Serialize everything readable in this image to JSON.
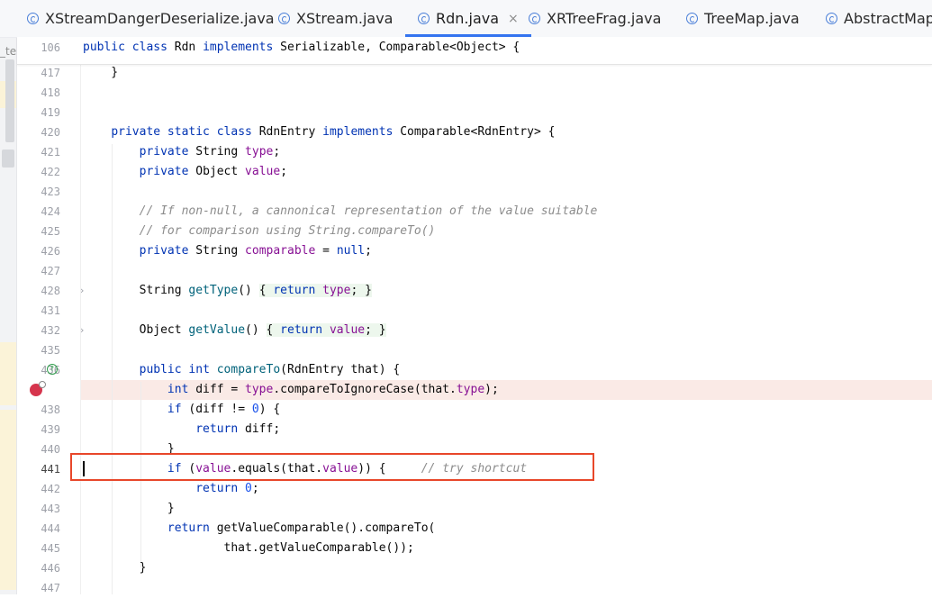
{
  "tabs": [
    {
      "label": "XStreamDangerDeserialize.java",
      "active": false
    },
    {
      "label": "XStream.java",
      "active": false
    },
    {
      "label": "Rdn.java",
      "active": true,
      "close": "×"
    },
    {
      "label": "XRTreeFrag.java",
      "active": false
    },
    {
      "label": "TreeMap.java",
      "active": false
    },
    {
      "label": "AbstractMap.ja",
      "active": false
    }
  ],
  "left_strip_fragment": "_te",
  "sticky_header": {
    "line_number": "106",
    "parts": [
      {
        "t": "public class ",
        "c": "kw"
      },
      {
        "t": "Rdn ",
        "c": ""
      },
      {
        "t": "implements ",
        "c": "kw"
      },
      {
        "t": "Serializable, Comparable<Object> {",
        "c": ""
      }
    ]
  },
  "code_lines": [
    {
      "n": "417",
      "parts": [
        {
          "t": "    }",
          "c": ""
        }
      ]
    },
    {
      "n": "418",
      "parts": []
    },
    {
      "n": "419",
      "parts": []
    },
    {
      "n": "420",
      "parts": [
        {
          "t": "    ",
          "c": ""
        },
        {
          "t": "private static class ",
          "c": "kw"
        },
        {
          "t": "RdnEntry ",
          "c": ""
        },
        {
          "t": "implements ",
          "c": "kw"
        },
        {
          "t": "Comparable<RdnEntry> {",
          "c": ""
        }
      ]
    },
    {
      "n": "421",
      "parts": [
        {
          "t": "        ",
          "c": ""
        },
        {
          "t": "private ",
          "c": "kw"
        },
        {
          "t": "String ",
          "c": ""
        },
        {
          "t": "type",
          "c": "fld"
        },
        {
          "t": ";",
          "c": ""
        }
      ]
    },
    {
      "n": "422",
      "parts": [
        {
          "t": "        ",
          "c": ""
        },
        {
          "t": "private ",
          "c": "kw"
        },
        {
          "t": "Object ",
          "c": ""
        },
        {
          "t": "value",
          "c": "fld"
        },
        {
          "t": ";",
          "c": ""
        }
      ]
    },
    {
      "n": "423",
      "parts": []
    },
    {
      "n": "424",
      "parts": [
        {
          "t": "        ",
          "c": ""
        },
        {
          "t": "// If non-null, a cannonical representation of the value suitable",
          "c": "cmt"
        }
      ]
    },
    {
      "n": "425",
      "parts": [
        {
          "t": "        ",
          "c": ""
        },
        {
          "t": "// for comparison using String.compareTo()",
          "c": "cmt"
        }
      ]
    },
    {
      "n": "426",
      "parts": [
        {
          "t": "        ",
          "c": ""
        },
        {
          "t": "private ",
          "c": "kw"
        },
        {
          "t": "String ",
          "c": ""
        },
        {
          "t": "comparable",
          "c": "fld"
        },
        {
          "t": " = ",
          "c": ""
        },
        {
          "t": "null",
          "c": "kw"
        },
        {
          "t": ";",
          "c": ""
        }
      ]
    },
    {
      "n": "427",
      "parts": []
    },
    {
      "n": "428",
      "fold": "›",
      "parts": [
        {
          "t": "        String ",
          "c": ""
        },
        {
          "t": "getType",
          "c": "fn"
        },
        {
          "t": "() ",
          "c": ""
        },
        {
          "t": "{ ",
          "c": "inl"
        },
        {
          "t": "return ",
          "c": "kw inl"
        },
        {
          "t": "type",
          "c": "fld inl"
        },
        {
          "t": "; ",
          "c": "inl"
        },
        {
          "t": "}",
          "c": "inl"
        }
      ]
    },
    {
      "n": "431",
      "parts": []
    },
    {
      "n": "432",
      "fold": "›",
      "parts": [
        {
          "t": "        Object ",
          "c": ""
        },
        {
          "t": "getValue",
          "c": "fn"
        },
        {
          "t": "() ",
          "c": ""
        },
        {
          "t": "{ ",
          "c": "inl"
        },
        {
          "t": "return ",
          "c": "kw inl"
        },
        {
          "t": "value",
          "c": "fld inl"
        },
        {
          "t": "; ",
          "c": "inl"
        },
        {
          "t": "}",
          "c": "inl"
        }
      ]
    },
    {
      "n": "435",
      "parts": []
    },
    {
      "n": "436",
      "impl": true,
      "parts": [
        {
          "t": "        ",
          "c": ""
        },
        {
          "t": "public int ",
          "c": "kw"
        },
        {
          "t": "compareTo",
          "c": "fn"
        },
        {
          "t": "(RdnEntry that) {",
          "c": ""
        }
      ]
    },
    {
      "n": "",
      "breakpoint": true,
      "parts": [
        {
          "t": "            ",
          "c": ""
        },
        {
          "t": "int ",
          "c": "kw"
        },
        {
          "t": "diff = ",
          "c": ""
        },
        {
          "t": "type",
          "c": "fld"
        },
        {
          "t": ".compareToIgnoreCase(that.",
          "c": ""
        },
        {
          "t": "type",
          "c": "fld"
        },
        {
          "t": ");",
          "c": ""
        }
      ]
    },
    {
      "n": "438",
      "parts": [
        {
          "t": "            ",
          "c": ""
        },
        {
          "t": "if ",
          "c": "kw"
        },
        {
          "t": "(diff != ",
          "c": ""
        },
        {
          "t": "0",
          "c": "num"
        },
        {
          "t": ") {",
          "c": ""
        }
      ]
    },
    {
      "n": "439",
      "parts": [
        {
          "t": "                ",
          "c": ""
        },
        {
          "t": "return ",
          "c": "kw"
        },
        {
          "t": "diff;",
          "c": ""
        }
      ]
    },
    {
      "n": "440",
      "parts": [
        {
          "t": "            }",
          "c": ""
        }
      ]
    },
    {
      "n": "441",
      "current": true,
      "parts": [
        {
          "t": "            ",
          "c": ""
        },
        {
          "t": "if ",
          "c": "kw"
        },
        {
          "t": "(",
          "c": ""
        },
        {
          "t": "value",
          "c": "fld"
        },
        {
          "t": ".equals(that.",
          "c": ""
        },
        {
          "t": "value",
          "c": "fld"
        },
        {
          "t": ")) {     ",
          "c": ""
        },
        {
          "t": "// try shortcut",
          "c": "cmt"
        }
      ]
    },
    {
      "n": "442",
      "parts": [
        {
          "t": "                ",
          "c": ""
        },
        {
          "t": "return ",
          "c": "kw"
        },
        {
          "t": "0",
          "c": "num"
        },
        {
          "t": ";",
          "c": ""
        }
      ]
    },
    {
      "n": "443",
      "parts": [
        {
          "t": "            }",
          "c": ""
        }
      ]
    },
    {
      "n": "444",
      "parts": [
        {
          "t": "            ",
          "c": ""
        },
        {
          "t": "return ",
          "c": "kw"
        },
        {
          "t": "getValueComparable().compareTo(",
          "c": ""
        }
      ]
    },
    {
      "n": "445",
      "parts": [
        {
          "t": "                    that.getValueComparable());",
          "c": ""
        }
      ]
    },
    {
      "n": "446",
      "parts": [
        {
          "t": "        }",
          "c": ""
        }
      ]
    },
    {
      "n": "447",
      "parts": []
    }
  ],
  "colors": {
    "keyword": "#0033b3",
    "field": "#871094",
    "method": "#00627a",
    "number": "#1750eb",
    "comment": "#8c8c8c",
    "breakpoint_line_bg": "#faeae6",
    "highlight_box": "#e8472a",
    "active_tab_underline": "#3574f0"
  },
  "icons": {
    "tab_icon": "class-c-icon",
    "breakpoint": "breakpoint-icon",
    "implementation": "implements-icon",
    "fold": "chevron-right-icon",
    "tab_close": "close-icon"
  }
}
